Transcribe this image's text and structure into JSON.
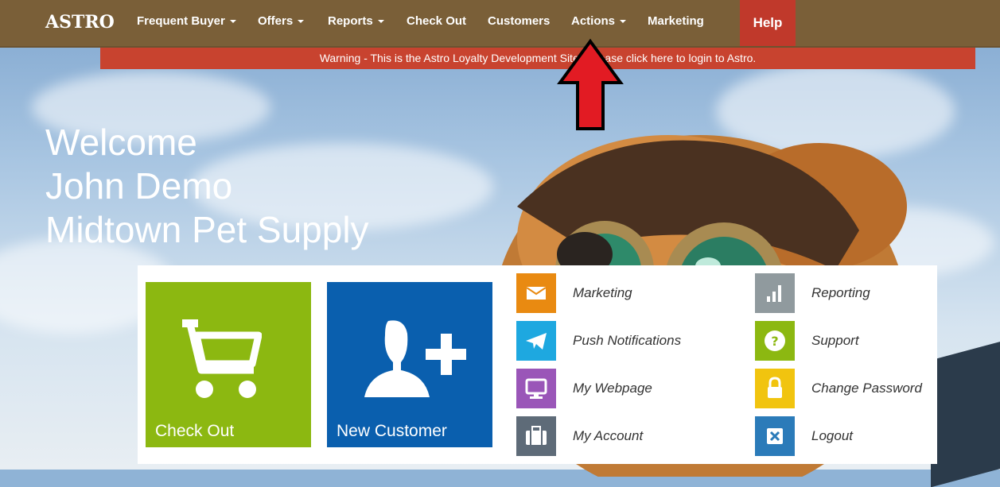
{
  "brand": "ASTRO",
  "nav": {
    "items": [
      {
        "label": "Frequent Buyer",
        "dropdown": true
      },
      {
        "label": "Offers",
        "dropdown": true
      },
      {
        "label": "Reports",
        "dropdown": true
      },
      {
        "label": "Check Out",
        "dropdown": false
      },
      {
        "label": "Customers",
        "dropdown": false
      },
      {
        "label": "Actions",
        "dropdown": true
      },
      {
        "label": "Marketing",
        "dropdown": false
      }
    ],
    "help": "Help"
  },
  "warning": "Warning - This is the Astro Loyalty Development Site - Please click here to login to Astro.",
  "welcome": {
    "line1": "Welcome",
    "line2": "John Demo",
    "line3": "Midtown Pet Supply"
  },
  "tiles": [
    {
      "label": "Check Out",
      "icon": "cart-icon",
      "color": "#8cb811"
    },
    {
      "label": "New Customer",
      "icon": "add-user-icon",
      "color": "#0a5fae"
    }
  ],
  "quick_links": [
    {
      "label": "Marketing",
      "icon": "envelope-icon",
      "color": "#e98a11"
    },
    {
      "label": "Push Notifications",
      "icon": "paper-plane-icon",
      "color": "#1ea8e0"
    },
    {
      "label": "My Webpage",
      "icon": "monitor-icon",
      "color": "#9a56b8"
    },
    {
      "label": "My Account",
      "icon": "briefcase-icon",
      "color": "#5e6b78"
    },
    {
      "label": "Reporting",
      "icon": "bar-chart-icon",
      "color": "#909a9e"
    },
    {
      "label": "Support",
      "icon": "question-icon",
      "color": "#8cb811"
    },
    {
      "label": "Change Password",
      "icon": "lock-icon",
      "color": "#f1c40f"
    },
    {
      "label": "Logout",
      "icon": "close-box-icon",
      "color": "#2b7bb9"
    }
  ],
  "colors": {
    "navbar": "#7a5f38",
    "help": "#c0392b",
    "warning": "#c8432f",
    "annotation_arrow": "#e21b23"
  }
}
